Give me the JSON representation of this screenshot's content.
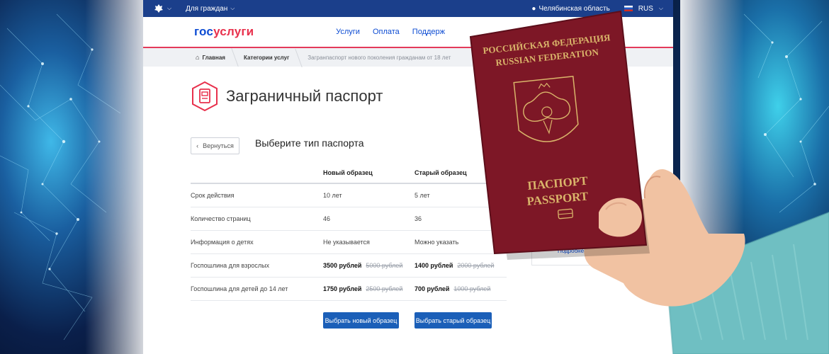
{
  "topbar": {
    "for_citizens": "Для граждан",
    "location": "Челябинская область",
    "language": "RUS"
  },
  "header": {
    "logo_part1": "гос",
    "logo_part2": "услуги",
    "nav": [
      "Услуги",
      "Оплата",
      "Поддерж"
    ]
  },
  "breadcrumbs": {
    "home": "Главная",
    "categories": "Категории услуг",
    "current": "Загранпаспорт нового поколения гражданам от 18 лет"
  },
  "page": {
    "title": "Заграничный паспорт",
    "back_label": "Вернуться",
    "choose_title": "Выберите тип паспорта"
  },
  "table": {
    "columns": [
      "",
      "Новый образец",
      "Старый образец"
    ],
    "rows": [
      {
        "label": "Срок действия",
        "new": "10 лет",
        "old": "5 лет"
      },
      {
        "label": "Количество страниц",
        "new": "46",
        "old": "36"
      },
      {
        "label": "Информация о детях",
        "new": "Не указывается",
        "old": "Можно указать"
      },
      {
        "label": "Госпошлина для взрослых",
        "new_price": "3500 рублей",
        "new_old_price": "5000 рублей",
        "old_price": "1400 рублей",
        "old_old_price": "2000 рублей"
      },
      {
        "label": "Госпошлина для детей до 14 лет",
        "new_price": "1750 рублей",
        "new_old_price": "2500 рублей",
        "old_price": "700 рублей",
        "old_old_price": "1000 рублей"
      }
    ]
  },
  "buttons": {
    "select_new": "Выбрать новый образец",
    "select_old": "Выбрать старый образец"
  },
  "side": {
    "more_link": "Подробнее"
  },
  "passport": {
    "line1": "РОССИЙСКАЯ ФЕДЕРАЦИЯ",
    "line2": "RUSSIAN FEDERATION",
    "line3": "ПАСПОРТ",
    "line4": "PASSPORT"
  },
  "colors": {
    "topbar": "#1b3f8b",
    "brand_blue": "#0d4cd3",
    "brand_red": "#e8304c",
    "passport": "#7a1522",
    "gold": "#d9b46a"
  }
}
